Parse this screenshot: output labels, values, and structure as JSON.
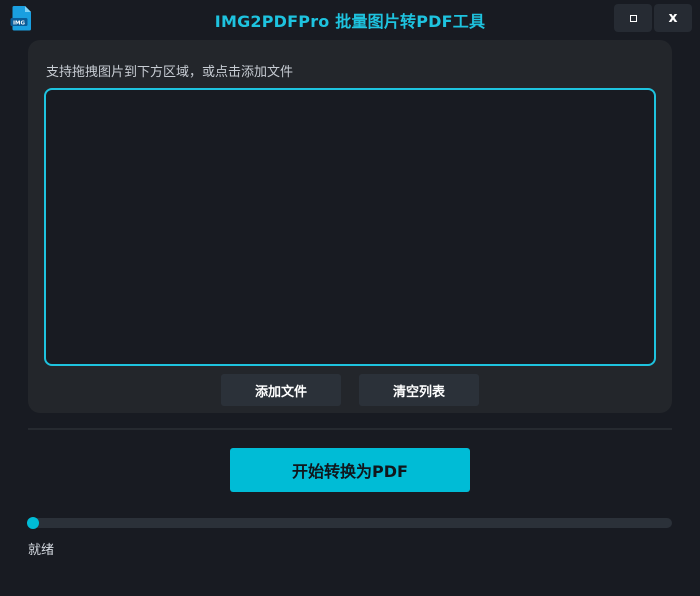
{
  "window": {
    "title": "IMG2PDFPro 批量图片转PDF工具",
    "icons": {
      "app": "pdf-file-icon",
      "app_badge": "IMG",
      "maximize": "maximize-icon",
      "close_label": "x"
    }
  },
  "panel": {
    "hint": "支持拖拽图片到下方区域，或点击添加文件",
    "drop_zone_items": [],
    "add_button": "添加文件",
    "clear_button": "清空列表"
  },
  "convert_button": "开始转换为PDF",
  "progress": {
    "percent": 0
  },
  "status_text": "就绪",
  "colors": {
    "accent": "#00bcd6",
    "title": "#1ec3df",
    "background": "#181b22",
    "panel": "#23262b",
    "button": "#2b3139"
  }
}
